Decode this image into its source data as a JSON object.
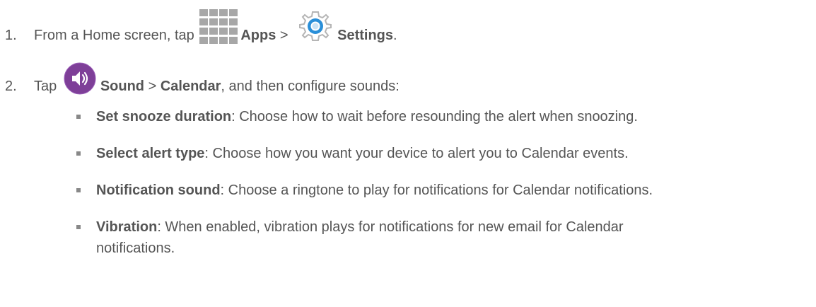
{
  "steps": [
    {
      "number": "1.",
      "text_before": "From a Home screen, tap ",
      "apps_label": "Apps",
      "separator": " > ",
      "settings_label": "Settings",
      "end": "."
    },
    {
      "number": "2.",
      "text_before": "Tap ",
      "sound_label": "Sound",
      "separator": " > ",
      "calendar_label": "Calendar",
      "text_after": ", and then configure sounds:"
    }
  ],
  "bullets": [
    {
      "term": "Set snooze duration",
      "description": ": Choose how to wait before resounding the alert when snoozing."
    },
    {
      "term": "Select alert type",
      "description": ": Choose how you want your device to alert you to Calendar events."
    },
    {
      "term": "Notification sound",
      "description": ": Choose a ringtone to play for notifications for Calendar notifications."
    },
    {
      "term": "Vibration",
      "description": ": When enabled, vibration plays for notifications for new email for Calendar notifications."
    }
  ],
  "icons": {
    "apps": "apps-grid-icon",
    "settings": "settings-gear-icon",
    "sound": "sound-speaker-icon"
  },
  "colors": {
    "text": "#555555",
    "apps_grid": "#a7a7a7",
    "sound_purple": "#7e3f98",
    "gear_blue": "#2a8fd8"
  }
}
